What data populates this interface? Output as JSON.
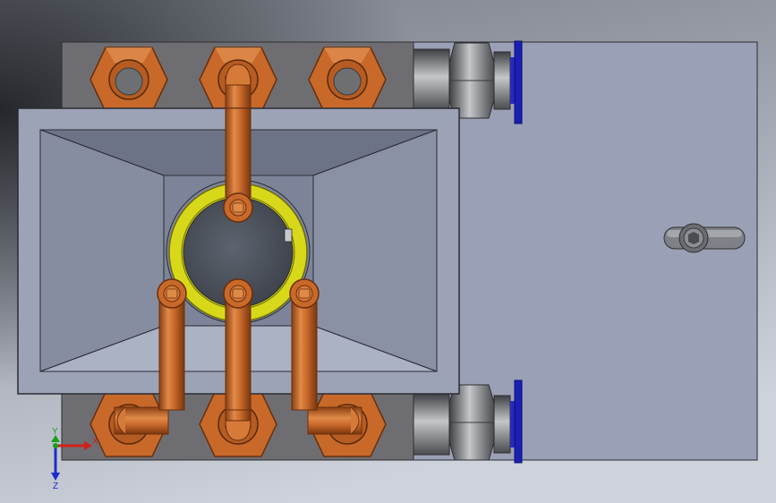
{
  "view": {
    "background_top": "#6f747c",
    "background_bottom": "#c3c8d2",
    "dark_corner": "#2a2d33"
  },
  "parts": {
    "manifold_body": {
      "color": "#6e6e72",
      "edge": "#2e2e30"
    },
    "box_frame": {
      "color": "#9ca3b6",
      "edge": "#2b2b33"
    },
    "box_inner_top": "#6d7387",
    "box_inner_side": "#888fa3",
    "box_inner_bottom": "#aab2c4",
    "box_floor": "#7b8297",
    "side_panel": "#9aa0b5",
    "copper": "#c8692a",
    "copper_dark": "#8a3f12",
    "copper_light": "#e79858",
    "seal_ring": "#d7d81a",
    "seal_ring_edge": "#6f6e0a",
    "bore": "#4f5560",
    "steel": "#8a8c90",
    "steel_dark": "#4b4d51",
    "blue_flange": "#1b1fb8",
    "latch_knob": "#6a6d72"
  },
  "triad": {
    "x_label": "X",
    "y_label": "Y",
    "z_label": "Z",
    "x_color": "#d0201c",
    "y_color": "#1aa01a",
    "z_color": "#1c2ccc"
  }
}
